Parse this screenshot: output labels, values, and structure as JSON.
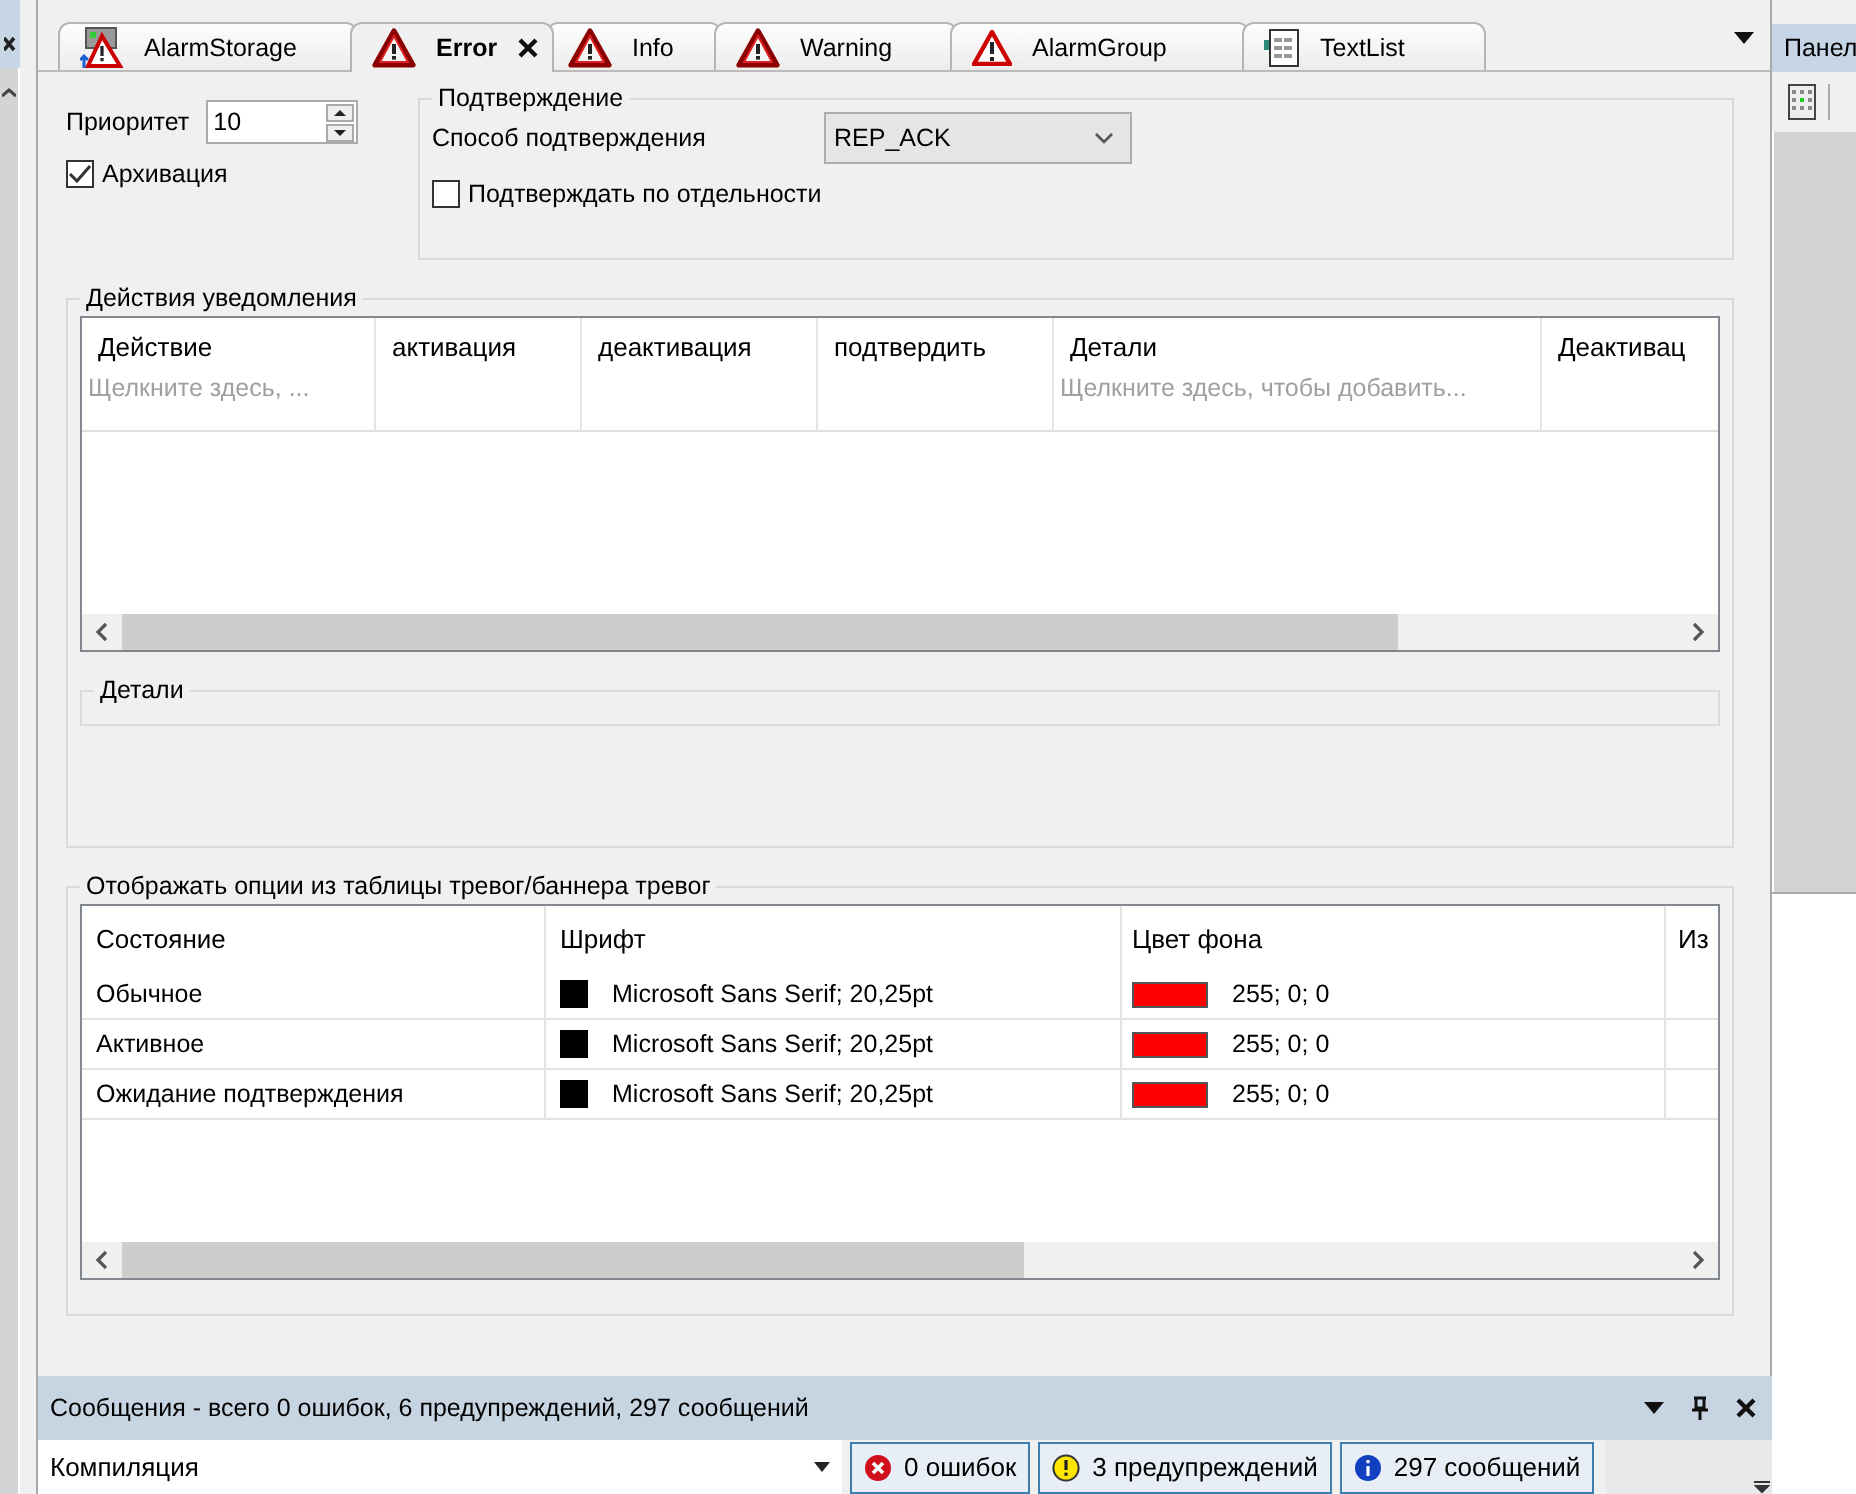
{
  "tabs": [
    {
      "label": "AlarmStorage",
      "kind": "storage",
      "selected": false
    },
    {
      "label": "Error",
      "kind": "alarm",
      "selected": true
    },
    {
      "label": "Info",
      "kind": "alarm",
      "selected": false
    },
    {
      "label": "Warning",
      "kind": "alarm",
      "selected": false
    },
    {
      "label": "AlarmGroup",
      "kind": "group",
      "selected": false
    },
    {
      "label": "TextList",
      "kind": "list",
      "selected": false
    }
  ],
  "side_panel": {
    "title": "Панел"
  },
  "priority": {
    "label": "Приоритет",
    "value": "10"
  },
  "archive": {
    "label": "Архивация",
    "checked": true
  },
  "confirmation": {
    "title": "Подтверждение",
    "method_label": "Способ подтверждения",
    "method_value": "REP_ACK",
    "separately": {
      "label": "Подтверждать по отдельности",
      "checked": false
    }
  },
  "actions": {
    "title": "Действия уведомления",
    "columns": [
      {
        "label": "Действие",
        "placeholder": "Щелкните здесь, ..."
      },
      {
        "label": "активация"
      },
      {
        "label": "деактивация"
      },
      {
        "label": "подтвердить"
      },
      {
        "label": "Детали",
        "placeholder": "Щелкните здесь, чтобы добавить..."
      },
      {
        "label": "Деактивац"
      }
    ]
  },
  "details": {
    "title": "Детали"
  },
  "display_options": {
    "title": "Отображать опции из таблицы тревог/баннера тревог",
    "columns": [
      "Состояние",
      "Шрифт",
      "Цвет фона",
      "Из"
    ],
    "rows": [
      {
        "state": "Обычное",
        "font": {
          "text": "Microsoft Sans Serif; 20,25pt",
          "color": "#000000"
        },
        "background": {
          "text": "255; 0; 0",
          "color": "#ff0000"
        }
      },
      {
        "state": "Активное",
        "font": {
          "text": "Microsoft Sans Serif; 20,25pt",
          "color": "#000000"
        },
        "background": {
          "text": "255; 0; 0",
          "color": "#ff0000"
        }
      },
      {
        "state": "Ожидание подтверждения",
        "font": {
          "text": "Microsoft Sans Serif; 20,25pt",
          "color": "#000000"
        },
        "background": {
          "text": "255; 0; 0",
          "color": "#ff0000"
        }
      }
    ]
  },
  "messages": {
    "title": "Сообщения - всего 0 ошибок, 6 предупреждений, 297 сообщений",
    "source": "Компиляция",
    "filters": [
      {
        "kind": "error",
        "label": "0 ошибок",
        "selected": true
      },
      {
        "kind": "warning",
        "label": "3 предупреждений",
        "selected": true
      },
      {
        "kind": "info",
        "label": "297 сообщений",
        "selected": true
      }
    ]
  }
}
